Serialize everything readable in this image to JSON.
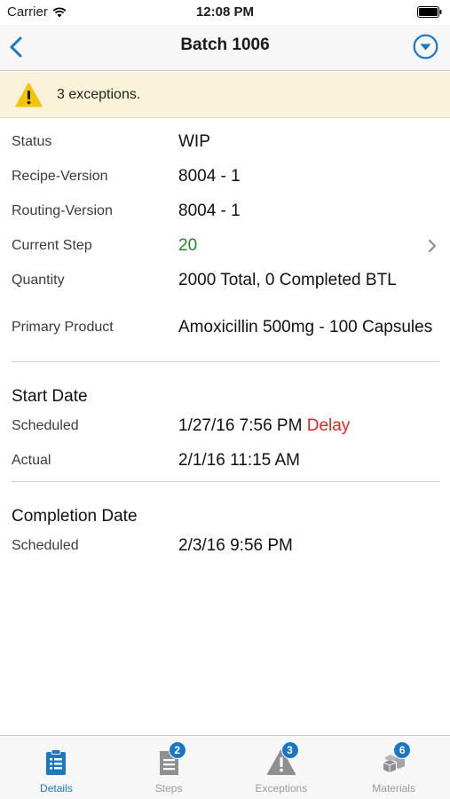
{
  "status_bar": {
    "carrier": "Carrier",
    "time": "12:08 PM"
  },
  "nav": {
    "title": "Batch 1006"
  },
  "banner": {
    "text": "3 exceptions."
  },
  "details": [
    {
      "label": "Status",
      "value": "WIP"
    },
    {
      "label": "Recipe-Version",
      "value": "8004 - 1"
    },
    {
      "label": "Routing-Version",
      "value": "8004 - 1"
    },
    {
      "label": "Current Step",
      "value": "20"
    },
    {
      "label": "Quantity",
      "value": "2000 Total, 0 Completed BTL"
    },
    {
      "label": "Primary Product",
      "value": "Amoxicillin 500mg - 100 Capsules"
    }
  ],
  "start_date": {
    "title": "Start Date",
    "scheduled_label": "Scheduled",
    "scheduled_value": "1/27/16 7:56 PM",
    "delay": "Delay",
    "actual_label": "Actual",
    "actual_value": "2/1/16 11:15 AM"
  },
  "completion_date": {
    "title": "Completion Date",
    "scheduled_label": "Scheduled",
    "scheduled_value": "2/3/16 9:56 PM"
  },
  "tabs": [
    {
      "label": "Details",
      "icon": "details-icon",
      "active": true
    },
    {
      "label": "Steps",
      "icon": "steps-icon",
      "badge": "2"
    },
    {
      "label": "Exceptions",
      "icon": "exceptions-icon",
      "badge": "3"
    },
    {
      "label": "Materials",
      "icon": "materials-icon",
      "badge": "6"
    }
  ],
  "colors": {
    "accent": "#1a78c2",
    "delay": "#e8231f",
    "step_green": "#1f8a1f",
    "banner_bg": "#faf3d9",
    "warning": "#f5c400"
  }
}
